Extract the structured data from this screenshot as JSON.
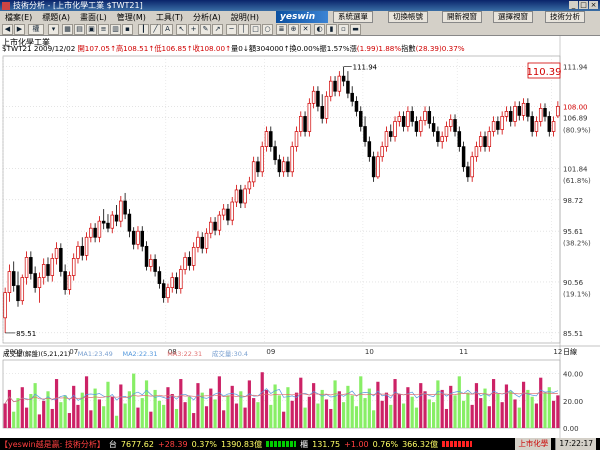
{
  "window": {
    "title": "技術分析 - [上市化學工業 $TWT21]"
  },
  "menu": [
    "檔案(E)",
    "標題(A)",
    "畫面(L)",
    "管理(M)",
    "工具(T)",
    "分析(A)",
    "說明(H)"
  ],
  "brand": {
    "logo": "yeswin"
  },
  "site_buttons": [
    "系統選單",
    "切換帳號",
    "開新視窗",
    "選擇視窗",
    "技術分析"
  ],
  "chart_info": {
    "name": "上市化學工業",
    "line": [
      {
        "t": "$TWT21 2009/12/02 ",
        "c": "#000"
      },
      {
        "t": "開107.05↑",
        "c": "#d00000"
      },
      {
        "t": "高108.51↑",
        "c": "#d00000"
      },
      {
        "t": "低106.85↑",
        "c": "#d00000"
      },
      {
        "t": "收108.00↑",
        "c": "#d00000"
      },
      {
        "t": "量0↓",
        "c": "#000"
      },
      {
        "t": "額304000↑",
        "c": "#000"
      },
      {
        "t": "換0.00%",
        "c": "#000"
      },
      {
        "t": "振1.57%",
        "c": "#000"
      },
      {
        "t": "漲",
        "c": "#000"
      },
      {
        "t": "(1.99)1.88%",
        "c": "#d00000"
      },
      {
        "t": "指數",
        "c": "#000"
      },
      {
        "t": "(28.39)0.37%",
        "c": "#d00000"
      }
    ]
  },
  "price_panel": {
    "high_label": "111.94",
    "low_label": "85.51",
    "current_box": "110.39",
    "y_ticks": [
      {
        "label": "111.94",
        "v": 111.94
      },
      {
        "label": "108.00",
        "v": 108.0,
        "color": "#d00000"
      },
      {
        "label": "106.89",
        "v": 106.89
      },
      {
        "label": "(80.9%)",
        "v": 105.7
      },
      {
        "label": "101.84",
        "v": 101.84
      },
      {
        "label": "(61.8%)",
        "v": 100.7
      },
      {
        "label": "98.72",
        "v": 98.72
      },
      {
        "label": "95.61",
        "v": 95.61
      },
      {
        "label": "(38.2%)",
        "v": 94.5
      },
      {
        "label": "90.56",
        "v": 90.56
      },
      {
        "label": "(19.1%)",
        "v": 89.4
      },
      {
        "label": "85.51",
        "v": 85.51
      }
    ],
    "x_labels": [
      {
        "label": "2009",
        "i": 0
      },
      {
        "label": "07",
        "i": 15
      },
      {
        "label": "08",
        "i": 38
      },
      {
        "label": "09",
        "i": 61
      },
      {
        "label": "10",
        "i": 84
      },
      {
        "label": "11",
        "i": 106
      },
      {
        "label": "12",
        "i": 128
      }
    ],
    "bottom_right_label": "日線"
  },
  "volume_panel": {
    "title_items": [
      {
        "t": "成交量(解盤)(5,21,21)",
        "c": "#000"
      },
      {
        "t": "MA1:23.49",
        "c": "#7aa0d0"
      },
      {
        "t": "MA2:22.31",
        "c": "#5599dd"
      },
      {
        "t": "MA3:22.31",
        "c": "#e07070"
      },
      {
        "t": "成交量:30.4",
        "c": "#7aa0d0"
      }
    ],
    "y_ticks": [
      {
        "label": "40.00",
        "v": 40
      },
      {
        "label": "20.00",
        "v": 20
      },
      {
        "label": "0.00",
        "v": 0
      }
    ]
  },
  "status": {
    "app": "【yeswin越是贏: 技術分析】",
    "tw_label": "台",
    "tw_index": "7677.62",
    "tw_change": "+28.39",
    "tw_pct": "0.37%",
    "tw_vol": "1390.83億",
    "otc_label": "櫃",
    "otc_index": "131.75",
    "otc_change": "+1.00",
    "otc_pct": "0.76%",
    "otc_vol": "366.32億",
    "stock": "上市化學",
    "time": "17:22:17"
  },
  "chart_data": {
    "type": "candlestick",
    "y_range": [
      84.5,
      113.0
    ],
    "candles": [
      [
        87.0,
        90.0,
        85.5,
        89.5
      ],
      [
        89.5,
        92.3,
        88.6,
        91.6
      ],
      [
        91.6,
        92.6,
        89.6,
        90.2
      ],
      [
        90.2,
        91.6,
        88.1,
        88.7
      ],
      [
        88.7,
        91.3,
        88.3,
        91.0
      ],
      [
        91.0,
        93.6,
        90.3,
        93.0
      ],
      [
        93.0,
        93.6,
        90.8,
        91.4
      ],
      [
        91.4,
        92.1,
        89.5,
        90.0
      ],
      [
        90.0,
        91.5,
        88.5,
        91.0
      ],
      [
        91.0,
        92.9,
        90.3,
        92.3
      ],
      [
        92.3,
        93.0,
        90.6,
        91.2
      ],
      [
        91.2,
        93.4,
        90.6,
        92.9
      ],
      [
        92.9,
        94.5,
        92.3,
        93.9
      ],
      [
        93.9,
        94.4,
        91.1,
        91.6
      ],
      [
        91.6,
        92.3,
        89.3,
        89.8
      ],
      [
        89.8,
        91.6,
        89.3,
        91.2
      ],
      [
        91.2,
        93.4,
        90.7,
        92.9
      ],
      [
        92.9,
        94.6,
        92.4,
        94.1
      ],
      [
        94.1,
        95.0,
        92.7,
        93.2
      ],
      [
        93.2,
        95.5,
        92.7,
        95.0
      ],
      [
        95.0,
        96.4,
        94.5,
        95.9
      ],
      [
        95.9,
        96.4,
        94.5,
        95.0
      ],
      [
        95.0,
        97.1,
        94.5,
        96.6
      ],
      [
        96.6,
        97.8,
        95.8,
        96.4
      ],
      [
        96.4,
        97.3,
        95.5,
        95.9
      ],
      [
        95.9,
        97.6,
        95.4,
        97.2
      ],
      [
        97.2,
        98.2,
        96.1,
        96.6
      ],
      [
        96.6,
        99.1,
        96.0,
        98.6
      ],
      [
        98.6,
        99.4,
        96.8,
        97.3
      ],
      [
        97.3,
        97.8,
        95.0,
        95.6
      ],
      [
        95.6,
        96.0,
        93.8,
        94.3
      ],
      [
        94.3,
        96.1,
        93.8,
        95.6
      ],
      [
        95.6,
        96.1,
        93.6,
        94.1
      ],
      [
        94.1,
        94.6,
        91.7,
        92.1
      ],
      [
        92.1,
        93.3,
        91.6,
        92.8
      ],
      [
        92.8,
        93.3,
        91.1,
        91.6
      ],
      [
        91.6,
        92.1,
        89.9,
        90.4
      ],
      [
        90.4,
        90.8,
        88.5,
        89.0
      ],
      [
        89.0,
        90.4,
        88.5,
        90.0
      ],
      [
        90.0,
        91.5,
        89.5,
        91.0
      ],
      [
        91.0,
        91.5,
        89.4,
        89.9
      ],
      [
        89.9,
        92.2,
        89.4,
        91.8
      ],
      [
        91.8,
        93.5,
        91.3,
        93.0
      ],
      [
        93.0,
        93.6,
        91.7,
        92.2
      ],
      [
        92.2,
        94.5,
        91.7,
        94.0
      ],
      [
        94.0,
        95.6,
        93.5,
        95.0
      ],
      [
        95.0,
        95.5,
        93.4,
        93.9
      ],
      [
        93.9,
        95.9,
        93.4,
        95.4
      ],
      [
        95.4,
        97.0,
        94.9,
        96.5
      ],
      [
        96.5,
        97.0,
        95.2,
        95.7
      ],
      [
        95.7,
        97.6,
        95.2,
        97.2
      ],
      [
        97.2,
        98.3,
        96.7,
        97.8
      ],
      [
        97.8,
        98.3,
        96.2,
        96.7
      ],
      [
        96.7,
        99.0,
        96.2,
        98.5
      ],
      [
        98.5,
        100.2,
        98.0,
        99.7
      ],
      [
        99.7,
        100.2,
        97.9,
        98.4
      ],
      [
        98.4,
        100.2,
        97.9,
        99.8
      ],
      [
        99.8,
        101.0,
        99.3,
        100.5
      ],
      [
        100.5,
        103.0,
        100.0,
        102.5
      ],
      [
        102.5,
        103.0,
        101.0,
        101.5
      ],
      [
        101.5,
        104.5,
        101.0,
        104.0
      ],
      [
        104.0,
        106.0,
        103.5,
        105.5
      ],
      [
        105.5,
        106.0,
        103.5,
        104.0
      ],
      [
        104.0,
        104.6,
        102.2,
        102.7
      ],
      [
        102.7,
        103.2,
        101.0,
        101.5
      ],
      [
        101.5,
        103.0,
        101.0,
        102.5
      ],
      [
        102.5,
        103.0,
        101.0,
        101.5
      ],
      [
        101.5,
        104.5,
        101.0,
        104.0
      ],
      [
        104.0,
        106.0,
        103.5,
        105.5
      ],
      [
        105.5,
        107.5,
        105.0,
        107.0
      ],
      [
        107.0,
        107.5,
        105.0,
        105.5
      ],
      [
        105.5,
        108.8,
        105.0,
        108.3
      ],
      [
        108.3,
        110.0,
        107.8,
        109.5
      ],
      [
        109.5,
        110.0,
        107.5,
        108.0
      ],
      [
        108.0,
        109.2,
        106.3,
        106.8
      ],
      [
        106.8,
        109.5,
        106.3,
        109.0
      ],
      [
        109.0,
        111.0,
        108.5,
        110.5
      ],
      [
        110.5,
        111.0,
        109.0,
        109.5
      ],
      [
        109.5,
        111.5,
        109.0,
        111.0
      ],
      [
        111.0,
        111.94,
        110.0,
        110.5
      ],
      [
        110.5,
        111.5,
        108.8,
        109.3
      ],
      [
        109.3,
        110.0,
        108.0,
        108.5
      ],
      [
        108.5,
        109.0,
        107.0,
        107.5
      ],
      [
        107.5,
        108.0,
        105.5,
        106.0
      ],
      [
        106.0,
        107.0,
        104.0,
        104.5
      ],
      [
        104.5,
        105.0,
        102.5,
        103.0
      ],
      [
        103.0,
        103.5,
        100.5,
        101.0
      ],
      [
        101.0,
        103.5,
        100.8,
        103.0
      ],
      [
        103.0,
        104.5,
        102.5,
        104.0
      ],
      [
        104.0,
        106.0,
        103.5,
        105.5
      ],
      [
        105.5,
        106.2,
        104.5,
        105.0
      ],
      [
        105.0,
        107.0,
        104.5,
        106.5
      ],
      [
        106.5,
        107.5,
        106.0,
        107.0
      ],
      [
        107.0,
        107.5,
        105.5,
        106.0
      ],
      [
        106.0,
        108.0,
        105.5,
        107.5
      ],
      [
        107.5,
        108.0,
        106.0,
        106.5
      ],
      [
        106.5,
        107.0,
        105.0,
        105.5
      ],
      [
        105.5,
        107.0,
        105.0,
        106.6
      ],
      [
        106.6,
        108.0,
        106.1,
        107.5
      ],
      [
        107.5,
        108.0,
        105.8,
        106.3
      ],
      [
        106.3,
        107.0,
        105.0,
        105.5
      ],
      [
        105.5,
        106.0,
        104.0,
        104.5
      ],
      [
        104.5,
        105.5,
        103.8,
        105.0
      ],
      [
        105.0,
        106.5,
        104.5,
        106.0
      ],
      [
        106.0,
        107.2,
        105.5,
        106.7
      ],
      [
        106.7,
        107.2,
        105.0,
        105.5
      ],
      [
        105.5,
        106.0,
        103.5,
        104.0
      ],
      [
        104.0,
        104.5,
        101.5,
        102.0
      ],
      [
        102.0,
        102.5,
        100.5,
        101.0
      ],
      [
        101.0,
        103.5,
        100.5,
        103.0
      ],
      [
        103.0,
        104.5,
        102.5,
        104.0
      ],
      [
        104.0,
        105.5,
        103.5,
        105.0
      ],
      [
        105.0,
        105.5,
        103.5,
        104.0
      ],
      [
        104.0,
        106.0,
        103.5,
        105.5
      ],
      [
        105.5,
        107.0,
        105.0,
        106.5
      ],
      [
        106.5,
        107.0,
        105.2,
        105.7
      ],
      [
        105.7,
        107.5,
        105.2,
        107.0
      ],
      [
        107.0,
        108.0,
        106.5,
        107.5
      ],
      [
        107.5,
        108.0,
        106.0,
        106.5
      ],
      [
        106.5,
        108.5,
        106.0,
        108.0
      ],
      [
        108.0,
        108.5,
        106.6,
        107.1
      ],
      [
        107.1,
        108.8,
        106.6,
        108.3
      ],
      [
        108.3,
        108.8,
        106.5,
        107.0
      ],
      [
        107.0,
        107.5,
        105.0,
        105.5
      ],
      [
        105.5,
        107.0,
        105.0,
        106.5
      ],
      [
        106.5,
        108.3,
        106.0,
        107.8
      ],
      [
        107.8,
        108.3,
        106.5,
        107.0
      ],
      [
        107.0,
        107.5,
        105.0,
        105.5
      ],
      [
        105.5,
        107.0,
        105.0,
        106.5
      ],
      [
        107.05,
        108.51,
        106.85,
        108.0
      ]
    ],
    "volume_max": 50,
    "volumes": [
      18,
      28,
      12,
      22,
      30,
      15,
      25,
      33,
      10,
      20,
      27,
      14,
      36,
      19,
      24,
      11,
      31,
      17,
      26,
      38,
      13,
      29,
      21,
      16,
      34,
      23,
      9,
      32,
      18,
      27,
      40,
      15,
      22,
      35,
      12,
      28,
      20,
      17,
      30,
      25,
      14,
      36,
      19,
      23,
      11,
      33,
      26,
      16,
      29,
      21,
      38,
      13,
      24,
      31,
      18,
      27,
      15,
      35,
      22,
      19,
      41,
      28,
      17,
      32,
      24,
      12,
      30,
      20,
      26,
      37,
      15,
      23,
      33,
      18,
      28,
      21,
      14,
      35,
      27,
      19,
      31,
      24,
      16,
      38,
      22,
      29,
      13,
      34,
      20,
      26,
      17,
      36,
      25,
      18,
      30,
      23,
      15,
      33,
      27,
      21,
      19,
      35,
      28,
      14,
      31,
      24,
      38,
      20,
      26,
      17,
      33,
      22,
      29,
      16,
      36,
      25,
      19,
      32,
      27,
      21,
      15,
      34,
      28,
      23,
      18,
      37,
      26,
      30,
      20,
      24
    ]
  }
}
